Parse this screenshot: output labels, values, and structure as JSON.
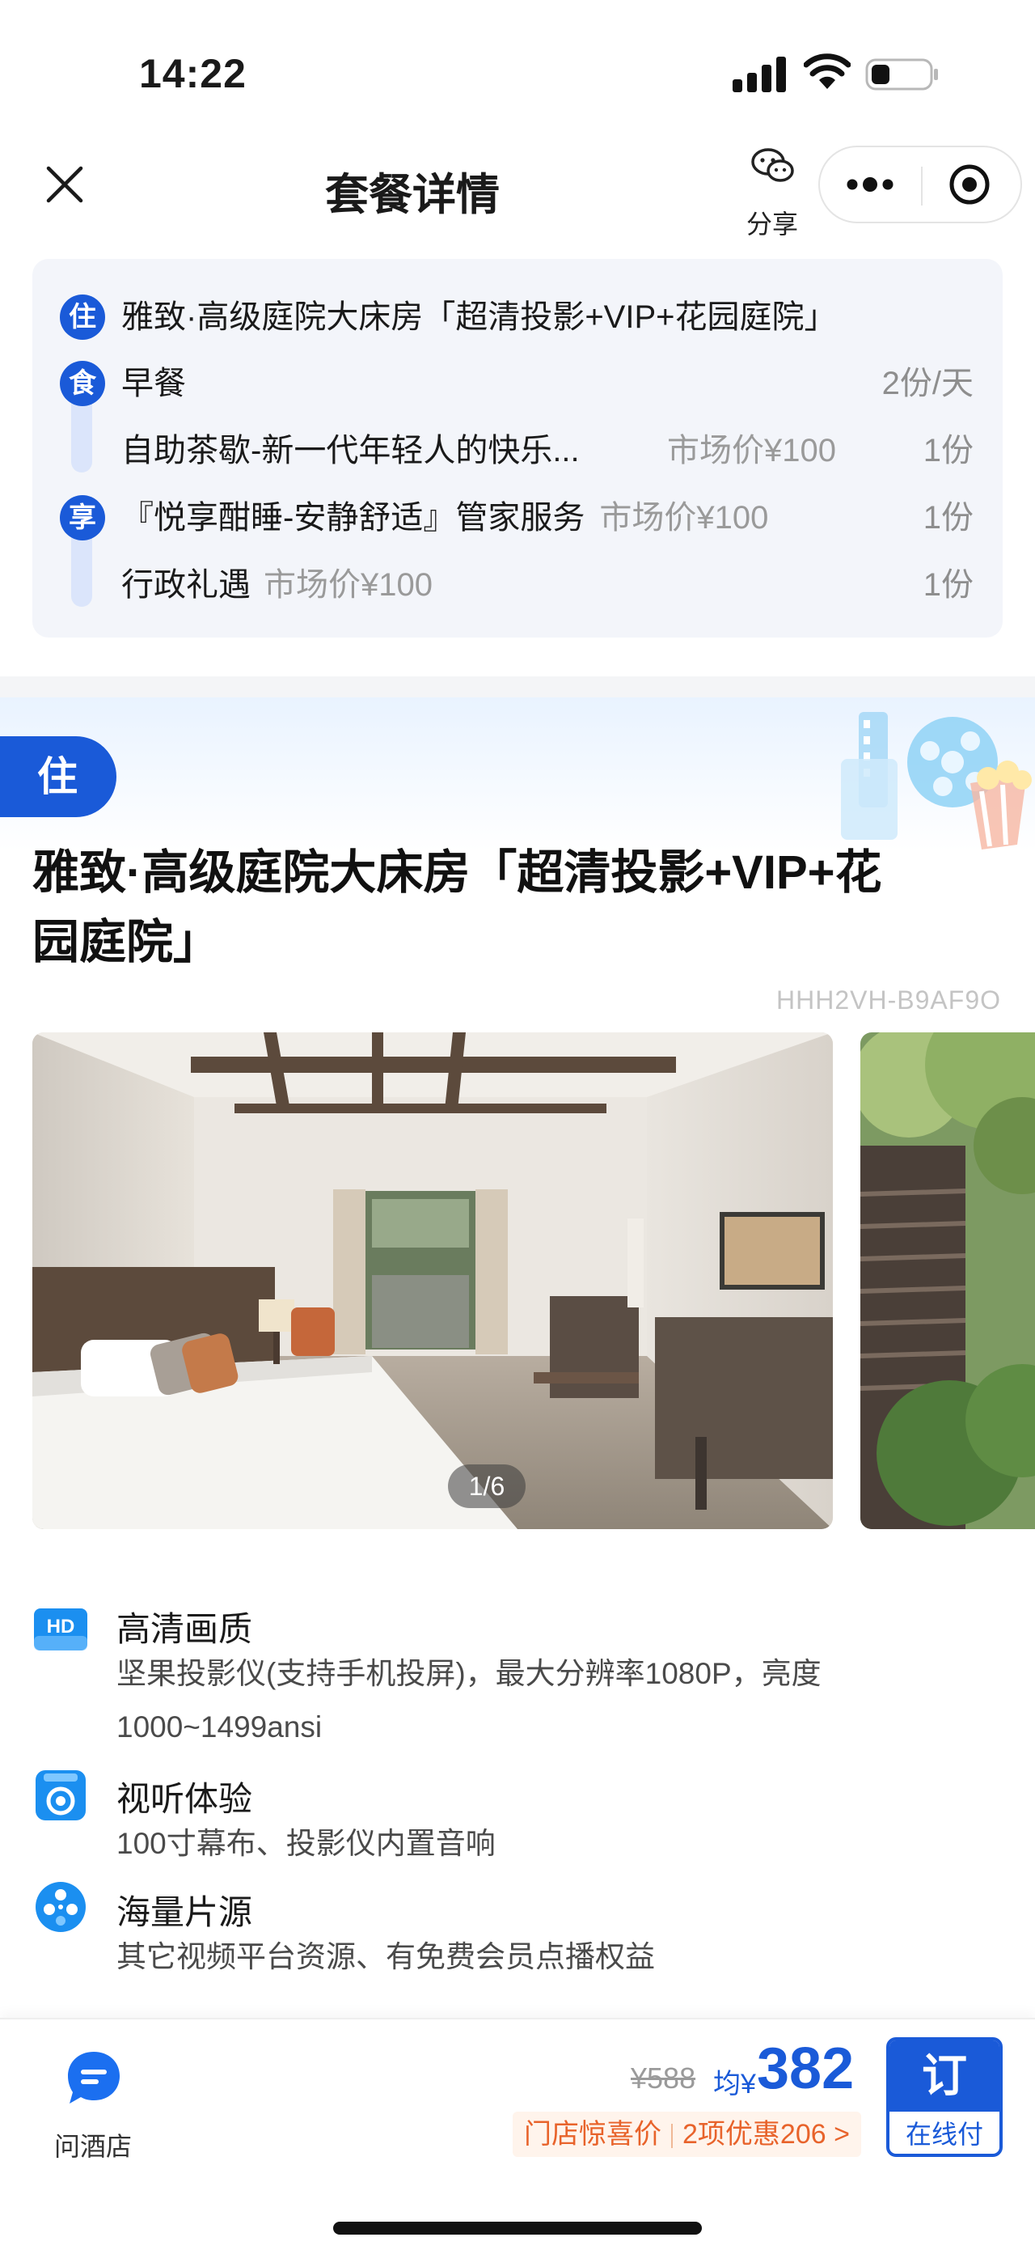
{
  "status_bar": {
    "time": "14:22"
  },
  "nav": {
    "title": "套餐详情",
    "share_label": "分享"
  },
  "package_summary": {
    "stay": {
      "tag": "住",
      "name": "雅致·高级庭院大床房「超清投影+VIP+花园庭院」"
    },
    "food": {
      "tag": "食",
      "items": [
        {
          "name": "早餐",
          "market_price": "",
          "quantity": "2份/天"
        },
        {
          "name": "自助茶歇-新一代年轻人的快乐...",
          "market_price": "市场价¥100",
          "quantity": "1份"
        }
      ]
    },
    "enjoy": {
      "tag": "享",
      "items": [
        {
          "name": "『悦享酣睡-安静舒适』管家服务",
          "market_price": "市场价¥100",
          "quantity": "1份"
        },
        {
          "name": "行政礼遇",
          "market_price": "市场价¥100",
          "quantity": "1份"
        }
      ]
    }
  },
  "room": {
    "tag": "住",
    "title_line1": "雅致·高级庭院大床房「超清投影+VIP+花",
    "title_line2": "园庭院」",
    "code": "HHH2VH-B9AF9O",
    "photo_counter": "1/6"
  },
  "features": [
    {
      "icon": "hd-icon",
      "title": "高清画质",
      "desc_line1": "坚果投影仪(支持手机投屏)，最大分辨率1080P，亮度",
      "desc_line2": "1000~1499ansi"
    },
    {
      "icon": "speaker-icon",
      "title": "视听体验",
      "desc_line1": "100寸幕布、投影仪内置音响",
      "desc_line2": ""
    },
    {
      "icon": "film-reel-icon",
      "title": "海量片源",
      "desc_line1": "其它视频平台资源、有免费会员点播权益",
      "desc_line2": ""
    }
  ],
  "bottom_bar": {
    "ask_hotel_label": "问酒店",
    "original_price": "¥588",
    "avg_label": "均¥",
    "price": "382",
    "promo_label": "门店惊喜价",
    "promo_discount": "2项优惠206 >",
    "book_label": "订",
    "book_sublabel": "在线付"
  },
  "colors": {
    "brand_blue": "#1a5ad8",
    "promo_orange": "#e8632b",
    "summary_bg": "#f3f5fa"
  }
}
